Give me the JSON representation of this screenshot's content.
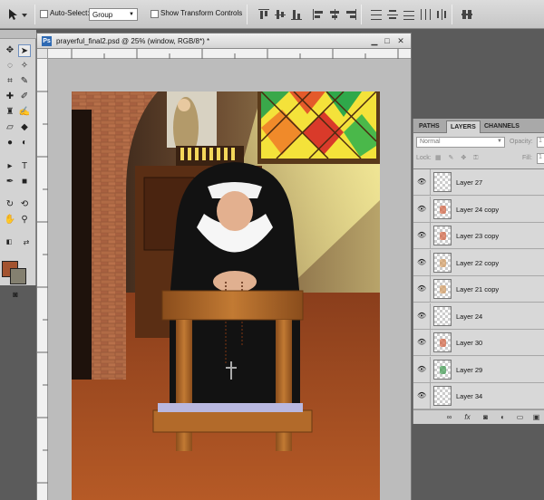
{
  "options_bar": {
    "auto_select_label": "Auto-Select:",
    "auto_select_value": "Group",
    "show_transform_label": "Show Transform Controls"
  },
  "toolbox": {
    "foreground_color": "#a3532f",
    "background_color": "#848070"
  },
  "document": {
    "title": "prayerful_final2.psd @ 25% (window, RGB/8*) *"
  },
  "layers_panel": {
    "tabs": [
      "PATHS",
      "LAYERS",
      "CHANNELS"
    ],
    "active_tab": "LAYERS",
    "blend_mode": "Normal",
    "opacity_label": "Opacity:",
    "opacity_value": "1",
    "lock_label": "Lock:",
    "fill_label": "Fill:",
    "fill_value": "1",
    "layers": [
      {
        "name": "Layer 27",
        "visible": true,
        "mark": ""
      },
      {
        "name": "Layer 24 copy",
        "visible": true,
        "mark": "#d46a4a"
      },
      {
        "name": "Layer 23 copy",
        "visible": true,
        "mark": "#d46a4a"
      },
      {
        "name": "Layer 22 copy",
        "visible": true,
        "mark": "#d4a06a"
      },
      {
        "name": "Layer 21 copy",
        "visible": true,
        "mark": "#d4a06a"
      },
      {
        "name": "Layer 24",
        "visible": true,
        "mark": ""
      },
      {
        "name": "Layer 30",
        "visible": true,
        "mark": "#d46a4a"
      },
      {
        "name": "Layer 29",
        "visible": true,
        "mark": "#4aa05a"
      },
      {
        "name": "Layer 34",
        "visible": true,
        "mark": ""
      }
    ]
  }
}
